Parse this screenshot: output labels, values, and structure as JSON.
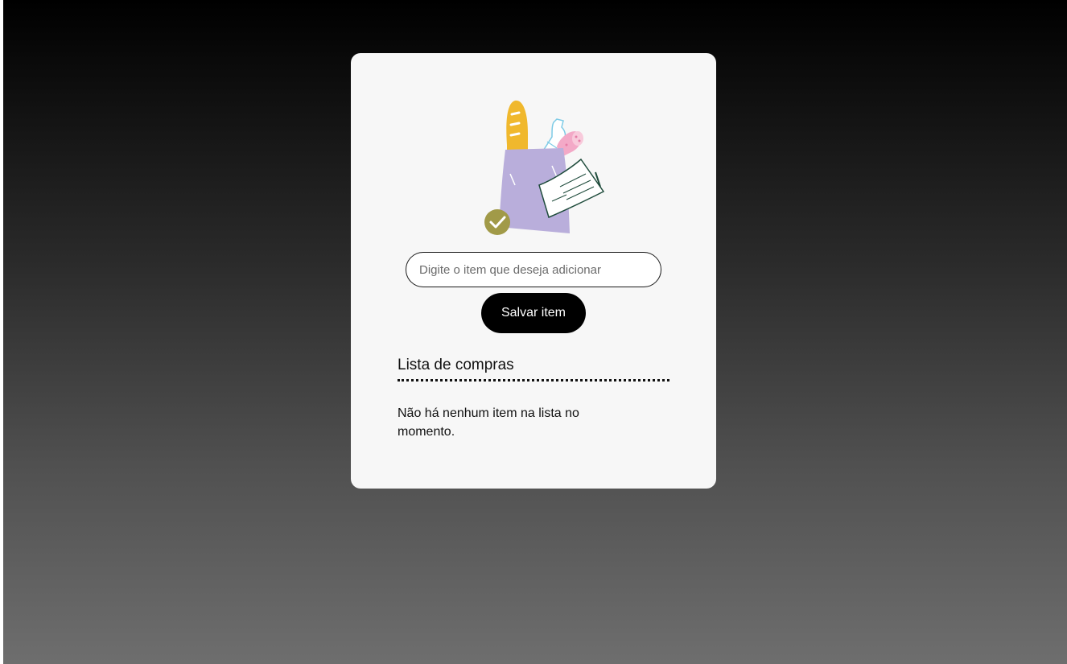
{
  "form": {
    "input_placeholder": "Digite o item que deseja adicionar",
    "input_value": "",
    "save_label": "Salvar item"
  },
  "list": {
    "title": "Lista de compras",
    "empty_message": "Não há nenhum item na lista no momento.",
    "items": []
  },
  "illustration": {
    "icon": "grocery-bag-illustration",
    "colors": {
      "bag": "#b9aedb",
      "bread": "#f0b82d",
      "salami": "#f3a9c7",
      "check_badge": "#a19a48",
      "receipt_ink": "#1f4c3c"
    }
  },
  "theme": {
    "background_top": "#000000",
    "background_bottom": "#6e6e6e",
    "card_background": "#f7f7f7",
    "button_background": "#000000",
    "button_text": "#ffffff"
  }
}
